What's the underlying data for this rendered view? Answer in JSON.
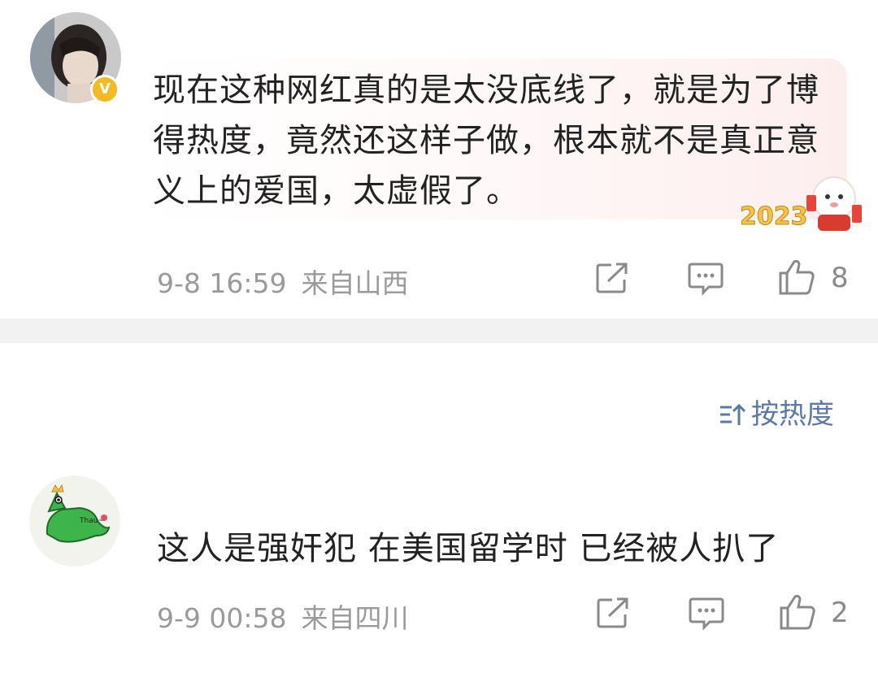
{
  "comments": [
    {
      "text": "现在这种网红真的是太没底线了，就是为了博得热度，竟然还这样子做，根本就不是真正意义上的爱国，太虚假了。",
      "date": "9-8 16:59",
      "location": "来自山西",
      "likes": "8",
      "verified": true,
      "sticker_text": "2023"
    },
    {
      "text": "这人是强奸犯 在美国留学时 已经被人扒了",
      "date": "9-9 00:58",
      "location": "来自四川",
      "likes": "2",
      "avatar_text": "Thau~"
    }
  ],
  "sort": {
    "label": "按热度"
  },
  "icons": {
    "share": "share-icon",
    "comment": "comment-icon",
    "like": "thumbs-up-icon",
    "sort": "sort-icon",
    "verified": "verified-badge-icon"
  },
  "colors": {
    "meta_gray": "#9a9a9a",
    "sort_blue": "#5a78a8",
    "verified_yellow": "#f5b921"
  }
}
